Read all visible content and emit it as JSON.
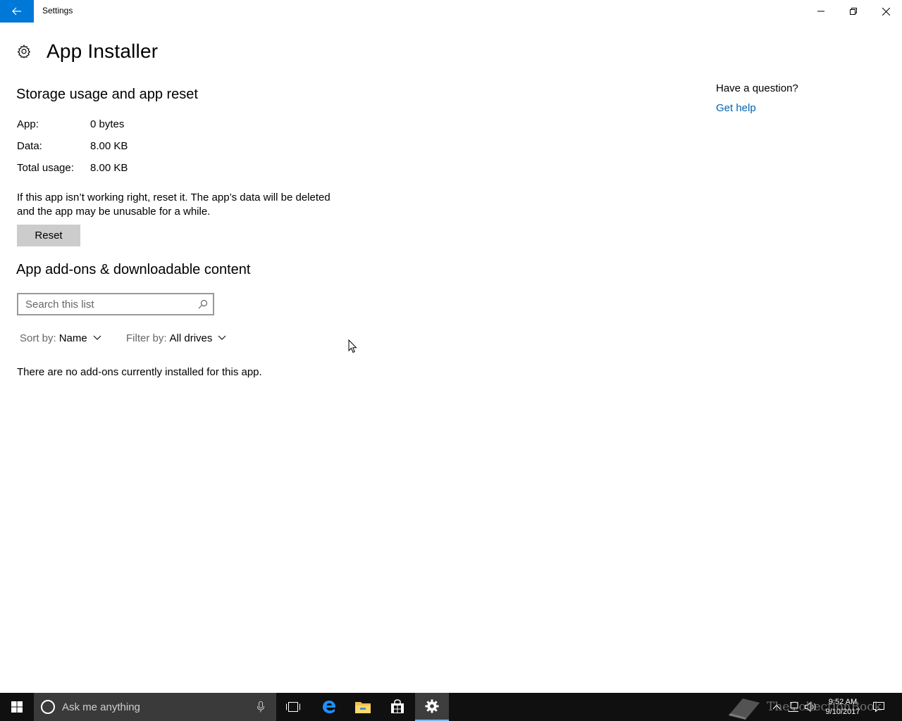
{
  "window": {
    "title": "Settings"
  },
  "page": {
    "title": "App Installer"
  },
  "storage": {
    "title": "Storage usage and app reset",
    "rows": [
      {
        "label": "App:",
        "value": "0 bytes"
      },
      {
        "label": "Data:",
        "value": "8.00 KB"
      },
      {
        "label": "Total usage:",
        "value": "8.00 KB"
      }
    ],
    "reset_description": "If this app isn’t working right, reset it. The app’s data will be deleted and the app may be unusable for a while.",
    "reset_label": "Reset"
  },
  "addons": {
    "title": "App add-ons & downloadable content",
    "search_placeholder": "Search this list",
    "search_value": "",
    "sort_label": "Sort by:",
    "sort_value": "Name",
    "filter_label": "Filter by:",
    "filter_value": "All drives",
    "empty_message": "There are no add-ons currently installed for this app."
  },
  "help": {
    "question": "Have a question?",
    "link_label": "Get help"
  },
  "taskbar": {
    "search_placeholder": "Ask me anything",
    "clock_time": "9:52 AM",
    "clock_date": "9/10/2017",
    "watermark_text": "TheCollectionBook"
  },
  "colors": {
    "accent": "#0078d7",
    "link": "#0063b1",
    "button_bg": "#cccccc",
    "taskbar_bg": "#101010"
  },
  "icons": [
    "back-arrow-icon",
    "minimize-icon",
    "maximize-icon",
    "close-icon",
    "gear-icon",
    "search-icon",
    "chevron-down-icon",
    "windows-start-icon",
    "cortana-icon",
    "microphone-icon",
    "task-view-icon",
    "edge-icon",
    "file-explorer-icon",
    "store-icon",
    "settings-icon",
    "tray-chevron-icon",
    "network-icon",
    "volume-icon",
    "action-center-icon"
  ]
}
